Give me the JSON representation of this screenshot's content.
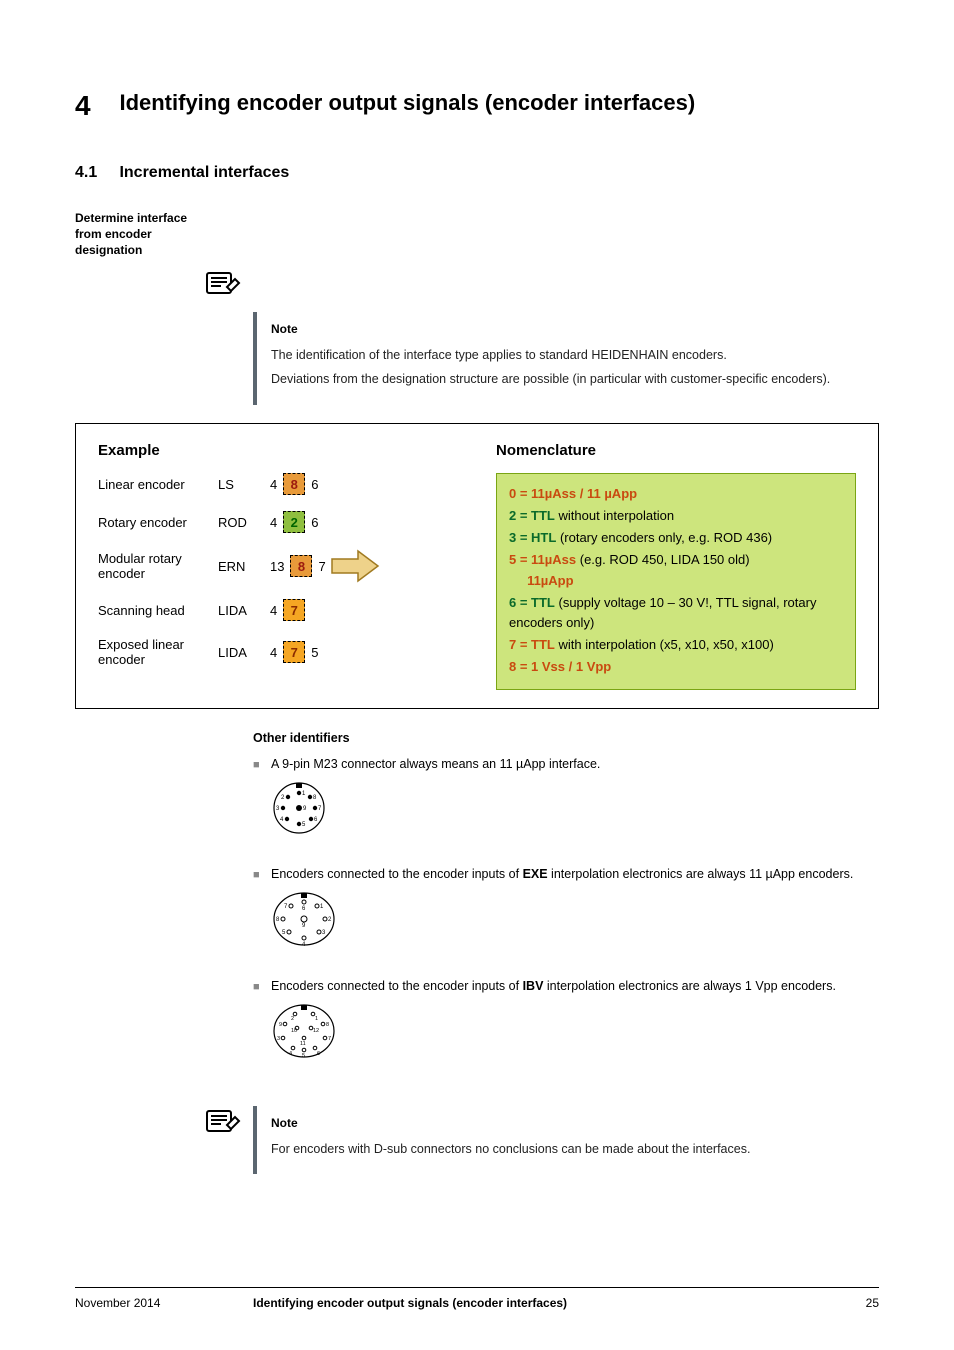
{
  "chapter": {
    "num": "4",
    "title": "Identifying encoder output signals (encoder interfaces)"
  },
  "section": {
    "num": "4.1",
    "title": "Incremental interfaces"
  },
  "side_label": "Determine interface from encoder designation",
  "note1": {
    "heading": "Note",
    "para1": "The identification of the interface type applies to standard HEIDENHAIN encoders.",
    "para2": "Deviations from the designation structure are possible (in particular with customer-specific encoders)."
  },
  "example": {
    "heading": "Example",
    "rows": [
      {
        "label": "Linear encoder",
        "code": "LS",
        "d1": "4",
        "d2": "8",
        "d3": "6",
        "hl": "red"
      },
      {
        "label": "Rotary encoder",
        "code": "ROD",
        "d1": "4",
        "d2": "2",
        "d3": "6",
        "hl": "green"
      },
      {
        "label": "Modular rotary encoder",
        "code": "ERN",
        "d1": "13",
        "d2": "8",
        "d3": "7",
        "hl": "red"
      },
      {
        "label": "Scanning head",
        "code": "LIDA",
        "d1": "4",
        "d2": "7",
        "d3": "",
        "hl": "orange"
      },
      {
        "label": "Exposed linear encoder",
        "code": "LIDA",
        "d1": "4",
        "d2": "7",
        "d3": "5",
        "hl": "orange"
      }
    ]
  },
  "nomenclature": {
    "heading": "Nomenclature",
    "l0a": "0 = 11µAss / 11 µApp",
    "l2a": "2 = TTL",
    "l2b": " without interpolation",
    "l3a": "3 = HTL",
    "l3b": " (rotary encoders only, e.g. ROD 436)",
    "l5a": "5 = 11µAss",
    "l5b": " (e.g. ROD 450, LIDA 150 old)",
    "l5c": "11µApp",
    "l6a": "6 = TTL",
    "l6b": " (supply voltage 10 – 30 V!, TTL signal, rotary encoders only)",
    "l7a": "7 = TTL",
    "l7b": " with interpolation (x5, x10, x50, x100)",
    "l8a": "8 = 1 Vss / 1 Vpp"
  },
  "other": {
    "heading": "Other identifiers",
    "b1a": "A 9-pin M23 connector always means an 11 µApp interface.",
    "b2a": "Encoders connected to the encoder inputs of ",
    "b2bold": "EXE",
    "b2b": " interpolation electronics are always 11 µApp encoders.",
    "b3a": "Encoders connected to the encoder inputs of ",
    "b3bold": "IBV",
    "b3b": " interpolation electronics are always 1 Vpp encoders."
  },
  "note2": {
    "heading": "Note",
    "para1": "For encoders with D-sub connectors no conclusions can be made about the interfaces."
  },
  "footer": {
    "date": "November 2014",
    "title": "Identifying encoder output signals (encoder interfaces)",
    "page": "25"
  }
}
